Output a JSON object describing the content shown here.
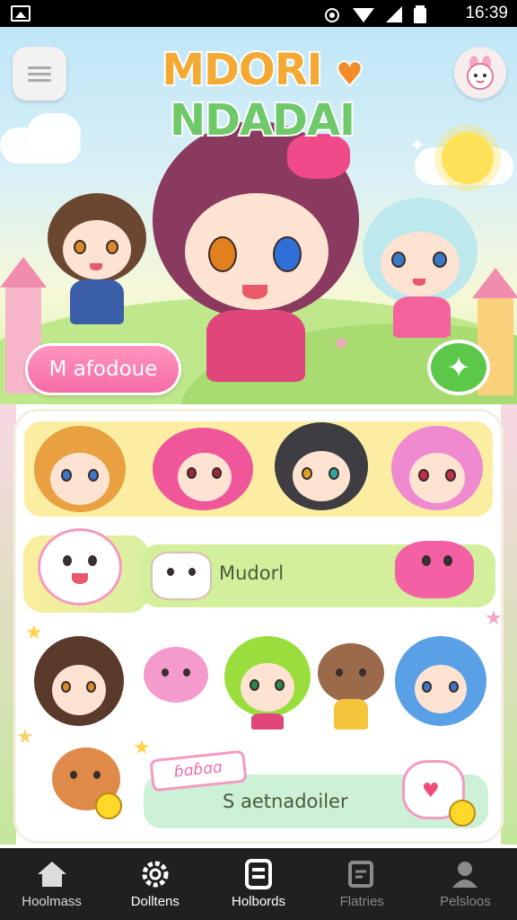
{
  "status_bar": {
    "time": "16:39"
  },
  "header": {
    "title_left": "MDORI",
    "title_heart": "♥",
    "title_right": "NDADAI",
    "menu_icon": "menu-icon",
    "profile_icon": "bunny-avatar-icon"
  },
  "hero": {
    "primary_button": "M afodoue",
    "action_icon": "sparkle-icon"
  },
  "content": {
    "row2_label": "Mudorl",
    "row4_ribbon": "ɓɑɓɑɑ",
    "row4_label": "S aetnadoiler"
  },
  "nav": {
    "items": [
      {
        "label": "Hoolmass",
        "icon": "home-icon",
        "active": false
      },
      {
        "label": "Dolltens",
        "icon": "gear-icon",
        "active": true
      },
      {
        "label": "Holbords",
        "icon": "card-icon",
        "active": true
      },
      {
        "label": "Flatries",
        "icon": "gallery-icon",
        "active": false
      },
      {
        "label": "Pelsloos",
        "icon": "person-icon",
        "active": false
      }
    ]
  },
  "colors": {
    "pink_accent": "#f56ca5",
    "green_accent": "#5cc84a",
    "navbar": "#202020"
  }
}
